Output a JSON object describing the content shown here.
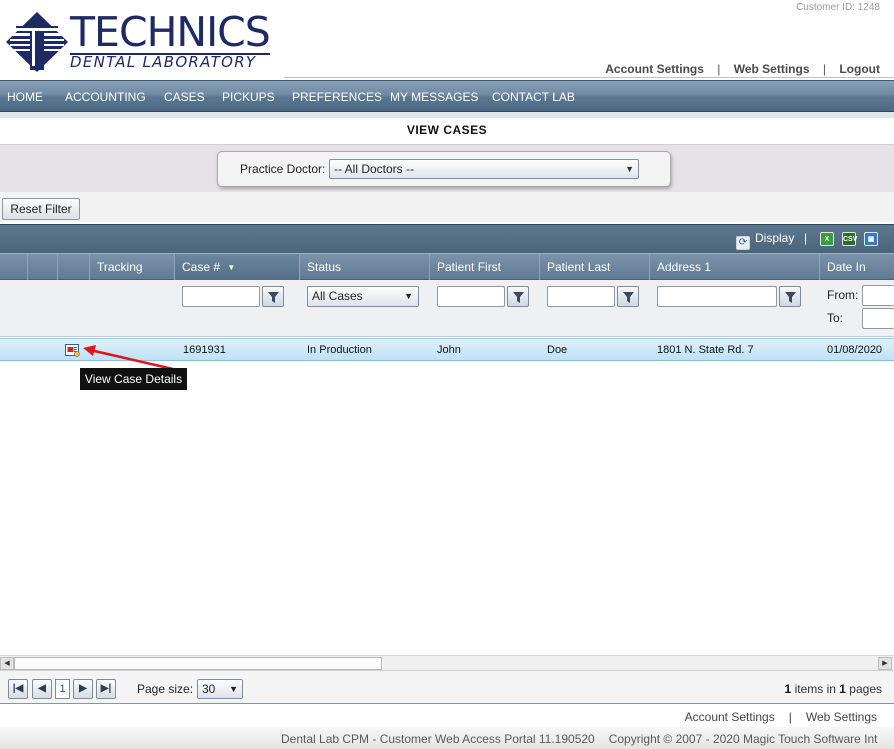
{
  "header": {
    "customer_id": "Customer ID: 1248",
    "logo": {
      "title": "TECHNICS",
      "subtitle": "DENTAL LABORATORY"
    },
    "links": {
      "account_settings": "Account Settings",
      "web_settings": "Web Settings",
      "logout": "Logout",
      "separator": "|"
    }
  },
  "nav": {
    "items": [
      "HOME",
      "ACCOUNTING",
      "CASES",
      "PICKUPS",
      "PREFERENCES",
      "MY MESSAGES",
      "CONTACT LAB"
    ]
  },
  "page": {
    "title": "VIEW CASES"
  },
  "filter": {
    "doctor_label": "Practice Doctor:",
    "doctor_value": "-- All Doctors --",
    "reset_button": "Reset Filter"
  },
  "toolbar": {
    "display_label": "Display",
    "separator": "|",
    "export_icons": [
      "excel-export-icon",
      "csv-export-icon",
      "image-export-icon"
    ]
  },
  "grid": {
    "columns": [
      "Tracking",
      "Case #",
      "Status",
      "Patient First",
      "Patient Last",
      "Address 1",
      "Date In"
    ],
    "sort_indicator": "▼",
    "status_filter_value": "All Cases",
    "date_from_label": "From:",
    "date_to_label": "To:",
    "rows": [
      {
        "case_no": "1691931",
        "status": "In Production",
        "patient_first": "John",
        "patient_last": "Doe",
        "address1": "1801 N. State Rd. 7",
        "date_in": "01/08/2020"
      }
    ],
    "tooltip": "View Case Details"
  },
  "pager": {
    "current_page": "1",
    "page_size_label": "Page size:",
    "page_size_value": "30",
    "items_count": "1",
    "items_text": "items in",
    "pages_count": "1",
    "pages_text": "pages"
  },
  "footer": {
    "account_settings": "Account Settings",
    "separator": "|",
    "web_settings": "Web Settings",
    "portal_text": "Dental Lab CPM - Customer Web Access Portal 11.190520",
    "copyright": "Copyright © 2007 - 2020 Magic Touch Software Int"
  },
  "colors": {
    "brand_navy": "#1e2a63",
    "nav_bar": "#5a7690",
    "row_highlight": "#bfe1f6",
    "annotation_arrow": "#e0141b"
  }
}
